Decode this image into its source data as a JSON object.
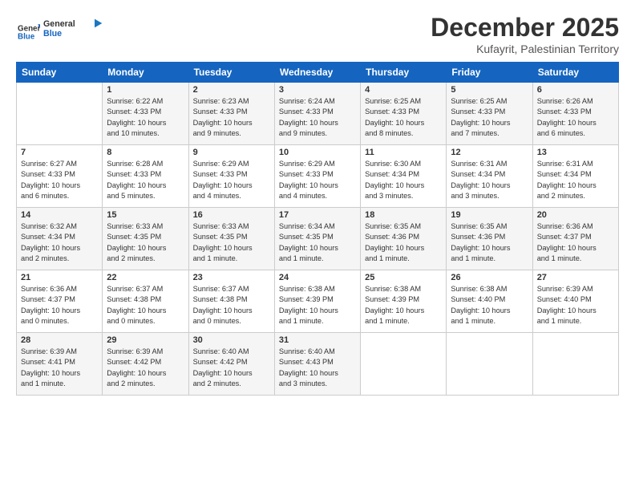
{
  "logo": {
    "line1": "General",
    "line2": "Blue"
  },
  "title": "December 2025",
  "subtitle": "Kufayrit, Palestinian Territory",
  "days_of_week": [
    "Sunday",
    "Monday",
    "Tuesday",
    "Wednesday",
    "Thursday",
    "Friday",
    "Saturday"
  ],
  "weeks": [
    [
      {
        "num": "",
        "info": ""
      },
      {
        "num": "1",
        "info": "Sunrise: 6:22 AM\nSunset: 4:33 PM\nDaylight: 10 hours\nand 10 minutes."
      },
      {
        "num": "2",
        "info": "Sunrise: 6:23 AM\nSunset: 4:33 PM\nDaylight: 10 hours\nand 9 minutes."
      },
      {
        "num": "3",
        "info": "Sunrise: 6:24 AM\nSunset: 4:33 PM\nDaylight: 10 hours\nand 9 minutes."
      },
      {
        "num": "4",
        "info": "Sunrise: 6:25 AM\nSunset: 4:33 PM\nDaylight: 10 hours\nand 8 minutes."
      },
      {
        "num": "5",
        "info": "Sunrise: 6:25 AM\nSunset: 4:33 PM\nDaylight: 10 hours\nand 7 minutes."
      },
      {
        "num": "6",
        "info": "Sunrise: 6:26 AM\nSunset: 4:33 PM\nDaylight: 10 hours\nand 6 minutes."
      }
    ],
    [
      {
        "num": "7",
        "info": "Sunrise: 6:27 AM\nSunset: 4:33 PM\nDaylight: 10 hours\nand 6 minutes."
      },
      {
        "num": "8",
        "info": "Sunrise: 6:28 AM\nSunset: 4:33 PM\nDaylight: 10 hours\nand 5 minutes."
      },
      {
        "num": "9",
        "info": "Sunrise: 6:29 AM\nSunset: 4:33 PM\nDaylight: 10 hours\nand 4 minutes."
      },
      {
        "num": "10",
        "info": "Sunrise: 6:29 AM\nSunset: 4:33 PM\nDaylight: 10 hours\nand 4 minutes."
      },
      {
        "num": "11",
        "info": "Sunrise: 6:30 AM\nSunset: 4:34 PM\nDaylight: 10 hours\nand 3 minutes."
      },
      {
        "num": "12",
        "info": "Sunrise: 6:31 AM\nSunset: 4:34 PM\nDaylight: 10 hours\nand 3 minutes."
      },
      {
        "num": "13",
        "info": "Sunrise: 6:31 AM\nSunset: 4:34 PM\nDaylight: 10 hours\nand 2 minutes."
      }
    ],
    [
      {
        "num": "14",
        "info": "Sunrise: 6:32 AM\nSunset: 4:34 PM\nDaylight: 10 hours\nand 2 minutes."
      },
      {
        "num": "15",
        "info": "Sunrise: 6:33 AM\nSunset: 4:35 PM\nDaylight: 10 hours\nand 2 minutes."
      },
      {
        "num": "16",
        "info": "Sunrise: 6:33 AM\nSunset: 4:35 PM\nDaylight: 10 hours\nand 1 minute."
      },
      {
        "num": "17",
        "info": "Sunrise: 6:34 AM\nSunset: 4:35 PM\nDaylight: 10 hours\nand 1 minute."
      },
      {
        "num": "18",
        "info": "Sunrise: 6:35 AM\nSunset: 4:36 PM\nDaylight: 10 hours\nand 1 minute."
      },
      {
        "num": "19",
        "info": "Sunrise: 6:35 AM\nSunset: 4:36 PM\nDaylight: 10 hours\nand 1 minute."
      },
      {
        "num": "20",
        "info": "Sunrise: 6:36 AM\nSunset: 4:37 PM\nDaylight: 10 hours\nand 1 minute."
      }
    ],
    [
      {
        "num": "21",
        "info": "Sunrise: 6:36 AM\nSunset: 4:37 PM\nDaylight: 10 hours\nand 0 minutes."
      },
      {
        "num": "22",
        "info": "Sunrise: 6:37 AM\nSunset: 4:38 PM\nDaylight: 10 hours\nand 0 minutes."
      },
      {
        "num": "23",
        "info": "Sunrise: 6:37 AM\nSunset: 4:38 PM\nDaylight: 10 hours\nand 0 minutes."
      },
      {
        "num": "24",
        "info": "Sunrise: 6:38 AM\nSunset: 4:39 PM\nDaylight: 10 hours\nand 1 minute."
      },
      {
        "num": "25",
        "info": "Sunrise: 6:38 AM\nSunset: 4:39 PM\nDaylight: 10 hours\nand 1 minute."
      },
      {
        "num": "26",
        "info": "Sunrise: 6:38 AM\nSunset: 4:40 PM\nDaylight: 10 hours\nand 1 minute."
      },
      {
        "num": "27",
        "info": "Sunrise: 6:39 AM\nSunset: 4:40 PM\nDaylight: 10 hours\nand 1 minute."
      }
    ],
    [
      {
        "num": "28",
        "info": "Sunrise: 6:39 AM\nSunset: 4:41 PM\nDaylight: 10 hours\nand 1 minute."
      },
      {
        "num": "29",
        "info": "Sunrise: 6:39 AM\nSunset: 4:42 PM\nDaylight: 10 hours\nand 2 minutes."
      },
      {
        "num": "30",
        "info": "Sunrise: 6:40 AM\nSunset: 4:42 PM\nDaylight: 10 hours\nand 2 minutes."
      },
      {
        "num": "31",
        "info": "Sunrise: 6:40 AM\nSunset: 4:43 PM\nDaylight: 10 hours\nand 3 minutes."
      },
      {
        "num": "",
        "info": ""
      },
      {
        "num": "",
        "info": ""
      },
      {
        "num": "",
        "info": ""
      }
    ]
  ]
}
